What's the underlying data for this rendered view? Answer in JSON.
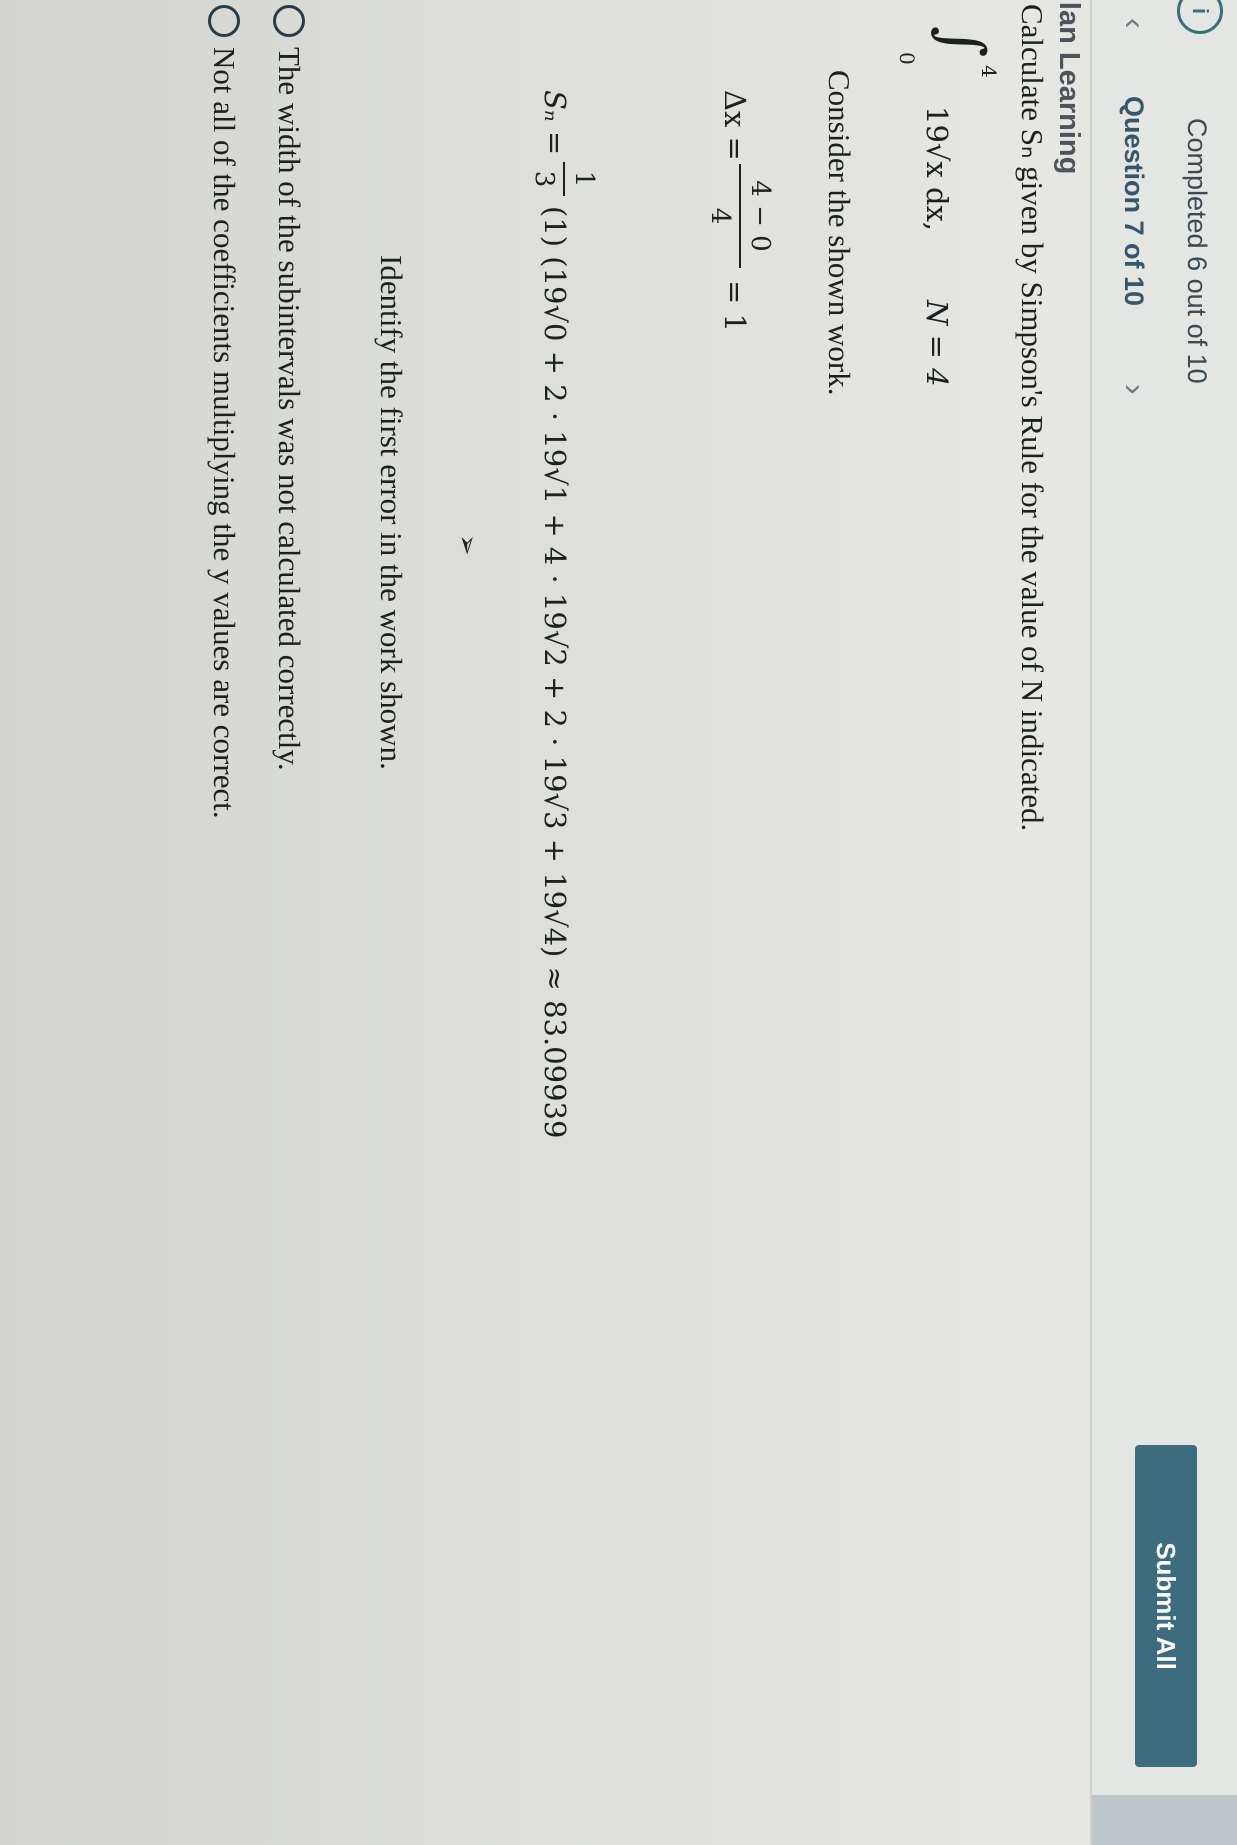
{
  "status": {
    "completed": "Completed 6 out of 10",
    "question_nav": "Question 7 of 10",
    "prev_icon": "chevron-left-icon",
    "next_icon": "chevron-right-icon",
    "info_icon": "info-icon",
    "submit_label": "Submit All"
  },
  "brand": "millan Learning",
  "question": {
    "prompt": "Calculate Sₙ given by Simpson's Rule for the value of N indicated.",
    "integral_upper": "4",
    "integral_lower": "0",
    "integrand": "19√x dx,",
    "n_value": "N = 4",
    "work_intro": "Consider the shown work.",
    "dx_label": "Δx =",
    "dx_numerator": "4 − 0",
    "dx_denominator": "4",
    "dx_result": "= 1",
    "sn_label": "Sₙ =",
    "sn_numerator": "1",
    "sn_denominator": "3",
    "sn_expression": "(1) (19√0 + 2 · 19√1 + 4 · 19√2 + 2 · 19√3 + 19√4) ≈ 83.09939",
    "identify_prompt": "Identify the first error in the work shown."
  },
  "options": [
    {
      "label": "The width of the subintervals was not calculated correctly."
    },
    {
      "label": "Not all of the coefficients multiplying the y values are correct."
    }
  ],
  "colors": {
    "submit_bg": "#3d6c7f",
    "accent": "#3b6f7a"
  }
}
